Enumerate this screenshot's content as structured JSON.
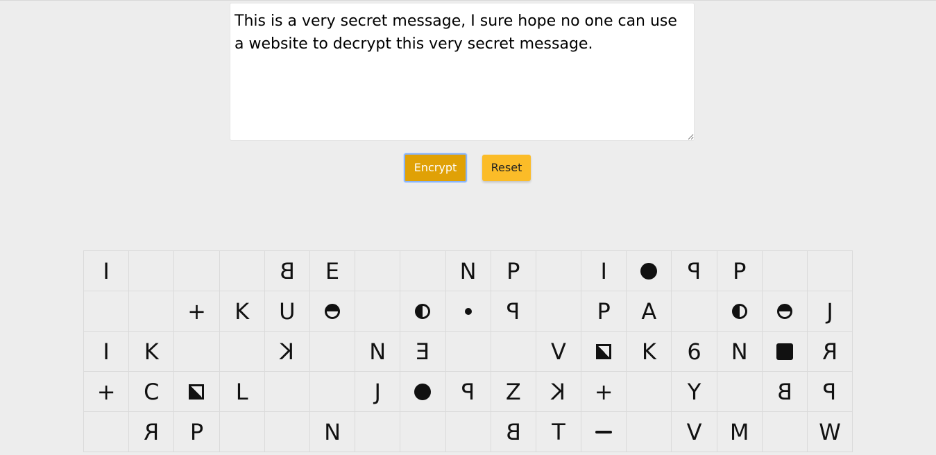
{
  "message": {
    "value": "This is a very secret message, I sure hope no one can use a website to decrypt this very secret message.",
    "placeholder": ""
  },
  "buttons": {
    "encrypt_label": "Encrypt",
    "reset_label": "Reset"
  },
  "colors": {
    "background": "#ededed",
    "encrypt_button": "#e0a106",
    "reset_button": "#fbbc28",
    "focus_ring": "#8ab4f8"
  },
  "cipher_grid": {
    "columns": 17,
    "rows": [
      [
        {
          "glyph": "text",
          "text": "I",
          "style": "plain",
          "name": "glyph-i-dotted"
        },
        {
          "glyph": "empty"
        },
        {
          "glyph": "empty"
        },
        {
          "glyph": "empty"
        },
        {
          "glyph": "text",
          "text": "B",
          "style": "mirror",
          "name": "glyph-b-mirrored"
        },
        {
          "glyph": "text",
          "text": "E",
          "style": "plain",
          "name": "glyph-e"
        },
        {
          "glyph": "empty"
        },
        {
          "glyph": "empty"
        },
        {
          "glyph": "text",
          "text": "N",
          "style": "plain",
          "name": "glyph-n"
        },
        {
          "glyph": "text",
          "text": "P",
          "style": "plain",
          "name": "glyph-p"
        },
        {
          "glyph": "empty"
        },
        {
          "glyph": "text",
          "text": "I",
          "style": "plain",
          "name": "glyph-i-dotted"
        },
        {
          "glyph": "shape",
          "shape": "dot-big",
          "name": "filled-circle-icon"
        },
        {
          "glyph": "text",
          "text": "P",
          "style": "mirror",
          "name": "glyph-p-mirrored"
        },
        {
          "glyph": "text",
          "text": "P",
          "style": "plain",
          "name": "glyph-p"
        },
        {
          "glyph": "empty"
        },
        {
          "glyph": "empty"
        }
      ],
      [
        {
          "glyph": "empty"
        },
        {
          "glyph": "empty"
        },
        {
          "glyph": "text",
          "text": "+",
          "style": "plain",
          "name": "glyph-plus"
        },
        {
          "glyph": "text",
          "text": "K",
          "style": "plain",
          "name": "glyph-k"
        },
        {
          "glyph": "text",
          "text": "U",
          "style": "plain",
          "name": "glyph-u"
        },
        {
          "glyph": "shape",
          "shape": "half-h",
          "name": "half-filled-circle-icon"
        },
        {
          "glyph": "empty"
        },
        {
          "glyph": "shape",
          "shape": "half-v",
          "name": "half-filled-circle-icon"
        },
        {
          "glyph": "shape",
          "shape": "dot-small",
          "name": "small-dot-icon"
        },
        {
          "glyph": "text",
          "text": "P",
          "style": "mirror",
          "name": "glyph-p-mirrored"
        },
        {
          "glyph": "empty"
        },
        {
          "glyph": "text",
          "text": "P",
          "style": "plain",
          "name": "glyph-p"
        },
        {
          "glyph": "text",
          "text": "A",
          "style": "plain",
          "name": "glyph-a"
        },
        {
          "glyph": "empty"
        },
        {
          "glyph": "shape",
          "shape": "half-v",
          "name": "half-filled-circle-icon"
        },
        {
          "glyph": "shape",
          "shape": "half-h",
          "name": "half-filled-circle-icon"
        },
        {
          "glyph": "text",
          "text": "J",
          "style": "plain",
          "name": "glyph-j"
        }
      ],
      [
        {
          "glyph": "text",
          "text": "I",
          "style": "plain",
          "name": "glyph-i"
        },
        {
          "glyph": "text",
          "text": "K",
          "style": "plain",
          "name": "glyph-k"
        },
        {
          "glyph": "empty"
        },
        {
          "glyph": "empty"
        },
        {
          "glyph": "text",
          "text": "K",
          "style": "mirror",
          "name": "glyph-k-mirrored"
        },
        {
          "glyph": "empty"
        },
        {
          "glyph": "text",
          "text": "N",
          "style": "plain",
          "name": "glyph-n"
        },
        {
          "glyph": "text",
          "text": "E",
          "style": "mirror",
          "name": "glyph-e-mirrored"
        },
        {
          "glyph": "empty"
        },
        {
          "glyph": "empty"
        },
        {
          "glyph": "text",
          "text": "V",
          "style": "plain",
          "name": "glyph-v"
        },
        {
          "glyph": "shape",
          "shape": "sq-diag",
          "name": "half-filled-square-icon"
        },
        {
          "glyph": "text",
          "text": "K",
          "style": "plain",
          "name": "glyph-k"
        },
        {
          "glyph": "text",
          "text": "6",
          "style": "plain",
          "name": "glyph-6"
        },
        {
          "glyph": "text",
          "text": "N",
          "style": "plain",
          "name": "glyph-n"
        },
        {
          "glyph": "shape",
          "shape": "sq-full",
          "name": "filled-square-icon"
        },
        {
          "glyph": "text",
          "text": "R",
          "style": "mirror",
          "name": "glyph-r-mirrored"
        }
      ],
      [
        {
          "glyph": "text",
          "text": "+",
          "style": "plain",
          "name": "glyph-plus"
        },
        {
          "glyph": "text",
          "text": "C",
          "style": "plain",
          "name": "glyph-c"
        },
        {
          "glyph": "shape",
          "shape": "sq-diag2",
          "name": "half-filled-square-icon"
        },
        {
          "glyph": "text",
          "text": "L",
          "style": "plain",
          "name": "glyph-l"
        },
        {
          "glyph": "empty"
        },
        {
          "glyph": "empty"
        },
        {
          "glyph": "text",
          "text": "J",
          "style": "plain",
          "name": "glyph-j"
        },
        {
          "glyph": "shape",
          "shape": "dot-big",
          "name": "filled-circle-icon"
        },
        {
          "glyph": "text",
          "text": "P",
          "style": "mirror",
          "name": "glyph-p-mirrored"
        },
        {
          "glyph": "text",
          "text": "Z",
          "style": "plain",
          "name": "glyph-z"
        },
        {
          "glyph": "text",
          "text": "K",
          "style": "mirror",
          "name": "glyph-k-mirrored"
        },
        {
          "glyph": "text",
          "text": "+",
          "style": "plain",
          "name": "glyph-plus"
        },
        {
          "glyph": "empty"
        },
        {
          "glyph": "text",
          "text": "Y",
          "style": "plain",
          "name": "glyph-y"
        },
        {
          "glyph": "empty"
        },
        {
          "glyph": "text",
          "text": "B",
          "style": "mirror",
          "name": "glyph-b-mirrored"
        },
        {
          "glyph": "text",
          "text": "P",
          "style": "mirror",
          "name": "glyph-p-mirrored"
        }
      ],
      [
        {
          "glyph": "empty"
        },
        {
          "glyph": "text",
          "text": "R",
          "style": "mirror",
          "name": "glyph-r-mirrored"
        },
        {
          "glyph": "text",
          "text": "P",
          "style": "plain",
          "name": "glyph-p"
        },
        {
          "glyph": "empty"
        },
        {
          "glyph": "empty"
        },
        {
          "glyph": "text",
          "text": "N",
          "style": "plain",
          "name": "glyph-n"
        },
        {
          "glyph": "empty"
        },
        {
          "glyph": "empty"
        },
        {
          "glyph": "empty"
        },
        {
          "glyph": "text",
          "text": "B",
          "style": "mirror",
          "name": "glyph-b-mirrored"
        },
        {
          "glyph": "text",
          "text": "T",
          "style": "plain",
          "name": "glyph-t"
        },
        {
          "glyph": "shape",
          "shape": "minus",
          "name": "minus-icon"
        },
        {
          "glyph": "empty"
        },
        {
          "glyph": "text",
          "text": "V",
          "style": "plain",
          "name": "glyph-v"
        },
        {
          "glyph": "text",
          "text": "M",
          "style": "plain",
          "name": "glyph-m"
        },
        {
          "glyph": "empty"
        },
        {
          "glyph": "text",
          "text": "W",
          "style": "plain",
          "name": "glyph-w"
        }
      ]
    ]
  }
}
